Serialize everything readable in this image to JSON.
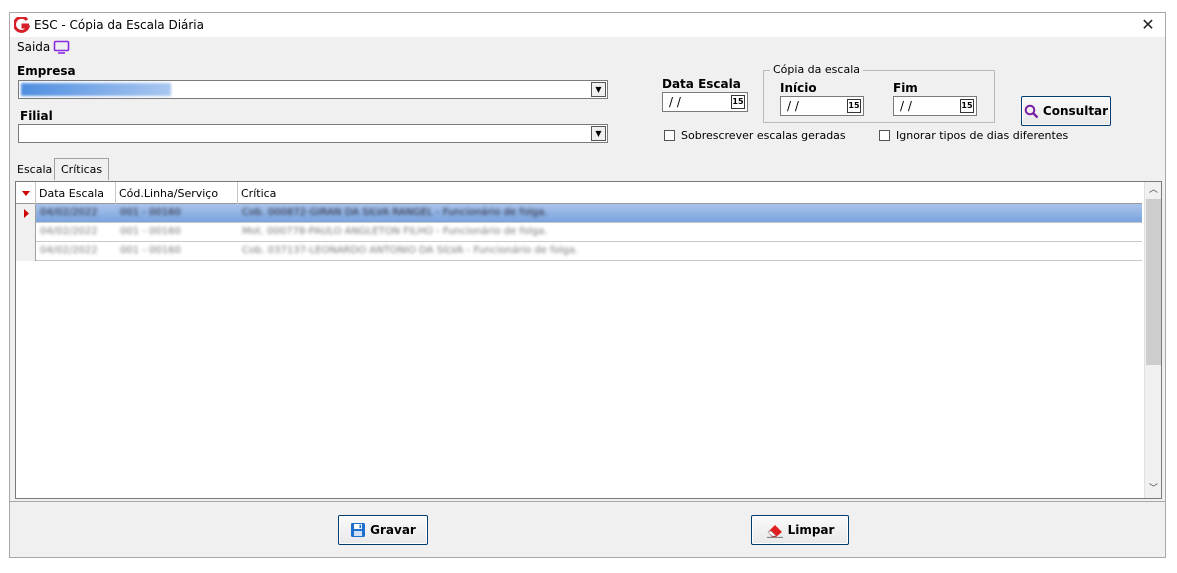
{
  "window": {
    "title": "ESC - Cópia da Escala Diária",
    "close_glyph": "✕"
  },
  "menu": {
    "saida_label": "Saida"
  },
  "form": {
    "empresa_label": "Empresa",
    "filial_label": "Filial",
    "data_escala_label": "Data Escala",
    "data_escala_value": "/ /",
    "copia_group_label": "Cópia da escala",
    "inicio_label": "Início",
    "inicio_value": "/ /",
    "fim_label": "Fim",
    "fim_value": "/ /",
    "calendar_glyph": "15",
    "consultar_label": "Consultar",
    "sobrescrever_label": "Sobrescrever escalas geradas",
    "ignorar_label": "Ignorar tipos de dias diferentes"
  },
  "tabs": [
    {
      "label": "Escala"
    },
    {
      "label": "Críticas"
    }
  ],
  "grid": {
    "columns": [
      "Data Escala",
      "Cód.Linha/Serviço",
      "Crítica"
    ],
    "rows": [
      {
        "data": "04/02/2022",
        "codigo": "001 - 00160",
        "critica": "Cob. 000872-GIRAN DA SILVA RANGEL - Funcionário de folga."
      },
      {
        "data": "04/02/2022",
        "codigo": "001 - 00160",
        "critica": "Mot. 000778-PAULO ANGLETON FILHO - Funcionário de folga."
      },
      {
        "data": "04/02/2022",
        "codigo": "001 - 00160",
        "critica": "Cob. 037137-LEONARDO ANTONIO DA SILVA - Funcionário de folga."
      }
    ]
  },
  "buttons": {
    "gravar_label": "Gravar",
    "limpar_label": "Limpar"
  },
  "colors": {
    "accent": "#003c74",
    "selection": "#7aa3de",
    "logo": "#d6202a",
    "monitor": "#8a2be2",
    "consultar_icon": "#7b1fa2"
  }
}
